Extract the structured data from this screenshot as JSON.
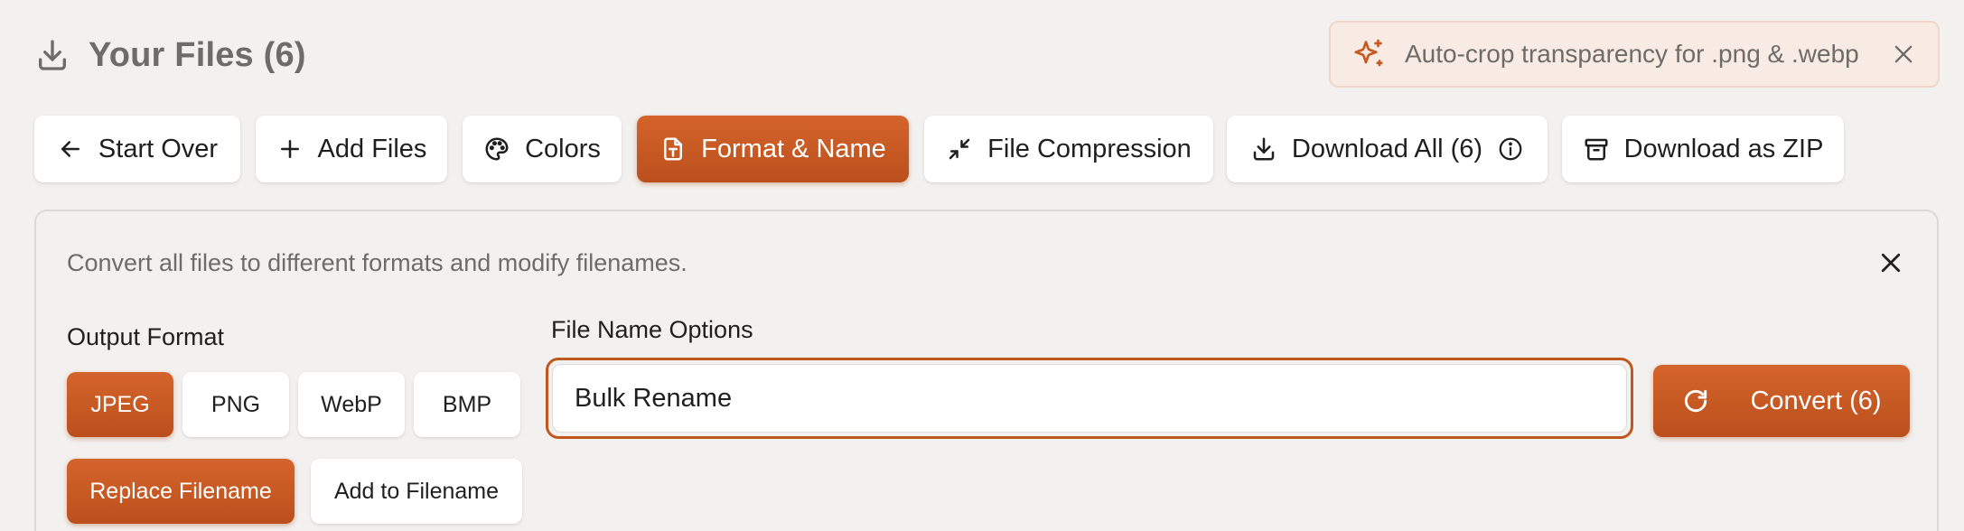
{
  "header": {
    "title": "Your Files (6)",
    "icon": "download-icon"
  },
  "notice": {
    "icon": "sparkles-icon",
    "text": "Auto-crop transparency for .png & .webp",
    "close_icon": "close-icon"
  },
  "toolbar": {
    "start_over": "Start Over",
    "add_files": "Add Files",
    "colors": "Colors",
    "format_name": "Format & Name",
    "file_compression": "File Compression",
    "download_all": "Download All (6)",
    "download_zip": "Download as ZIP",
    "active_item": "format_name"
  },
  "panel": {
    "description": "Convert all files to different formats and modify filenames.",
    "output_format_label": "Output Format",
    "formats": [
      "JPEG",
      "PNG",
      "WebP",
      "BMP"
    ],
    "selected_format": "JPEG",
    "filename_modes": [
      "Replace Filename",
      "Add to Filename"
    ],
    "selected_filename_mode": "Replace Filename",
    "file_name_label": "File Name Options",
    "file_name_value": "Bulk Rename",
    "convert_label": "Convert (6)"
  },
  "colors": {
    "accent": "#c75a23",
    "background": "#f3f1ef",
    "notice_bg": "#f7ebe3",
    "muted_text": "#6f6b68"
  }
}
